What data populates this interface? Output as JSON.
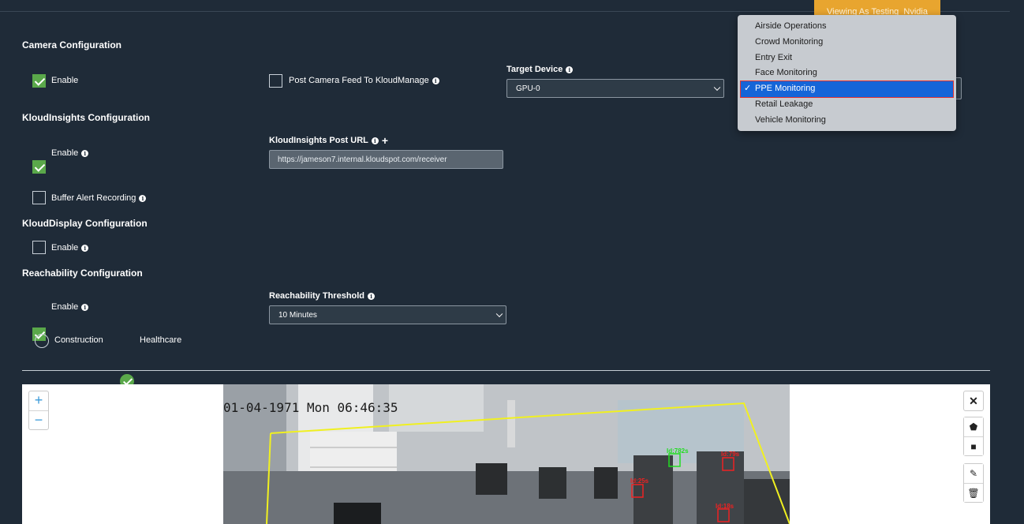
{
  "header": {
    "viewing_as": "Viewing As Testing_Nvidia"
  },
  "camera_config": {
    "title": "Camera Configuration",
    "enable_label": "Enable",
    "enable_checked": true,
    "post_feed_label": "Post Camera Feed To KloudManage",
    "post_feed_checked": false,
    "target_device_label": "Target Device",
    "target_device_value": "GPU-0"
  },
  "insights_config": {
    "title": "KloudInsights Configuration",
    "enable_label": "Enable",
    "enable_checked": true,
    "post_url_label": "KloudInsights Post URL",
    "post_url_value": "https://jameson7.internal.kloudspot.com/receiver",
    "buffer_label": "Buffer Alert Recording",
    "buffer_checked": false
  },
  "display_config": {
    "title": "KloudDisplay Configuration",
    "enable_label": "Enable",
    "enable_checked": false
  },
  "reachability_config": {
    "title": "Reachability Configuration",
    "enable_label": "Enable",
    "enable_checked": true,
    "threshold_label": "Reachability Threshold",
    "threshold_value": "10 Minutes",
    "options": [
      {
        "label": "Construction",
        "checked": false
      },
      {
        "label": "Healthcare",
        "checked": true
      }
    ]
  },
  "use_case_dropdown": {
    "items": [
      "Airside Operations",
      "Crowd Monitoring",
      "Entry Exit",
      "Face Monitoring",
      "PPE Monitoring",
      "Retail Leakage",
      "Vehicle Monitoring"
    ],
    "selected": "PPE Monitoring"
  },
  "video": {
    "timestamp": "01-04-1971 Mon 06:46:35",
    "zoom_in": "+",
    "zoom_out": "−",
    "detections": [
      {
        "label": "Id:782s",
        "color": "#22dd22"
      },
      {
        "label": "Id:79s",
        "color": "#ee2222"
      },
      {
        "label": "Id:25s",
        "color": "#ee2222"
      },
      {
        "label": "Id:18s",
        "color": "#ee2222"
      }
    ]
  },
  "colors": {
    "background": "#1f2b38",
    "accent_green": "#5aa84a",
    "badge_orange": "#e8a52f",
    "selection_blue": "#1565d8",
    "highlight_red": "#e03333"
  }
}
